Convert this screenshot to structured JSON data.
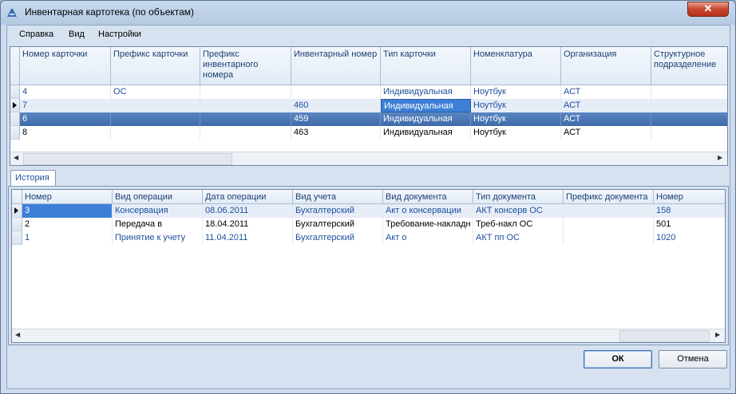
{
  "window": {
    "title": "Инвентарная картотека (по объектам)",
    "close_glyph": "✕"
  },
  "menu": {
    "items": [
      "Справка",
      "Вид",
      "Настройки"
    ]
  },
  "cards": {
    "columns": [
      "Номер карточки",
      "Префикс карточки",
      "Префикс инвентарного номера",
      "Инвентарный номер",
      "Тип карточки",
      "Номенклатура",
      "Организация",
      "Структурное подразделение"
    ],
    "rows": [
      [
        "4",
        "ОС",
        "",
        "",
        "Индивидуальная",
        "Ноутбук",
        "АСТ",
        ""
      ],
      [
        "7",
        "",
        "",
        "460",
        "Индивидуальная",
        "Ноутбук",
        "АСТ",
        ""
      ],
      [
        "6",
        "",
        "",
        "459",
        "Индивидуальная",
        "Ноутбук",
        "АСТ",
        ""
      ],
      [
        "8",
        "",
        "",
        "463",
        "Индивидуальная",
        "Ноутбук",
        "АСТ",
        ""
      ]
    ]
  },
  "history": {
    "tab_label": "История",
    "columns": [
      "Номер",
      "Вид операции",
      "Дата операции",
      "Вид учета",
      "Вид документа",
      "Тип документа",
      "Префикс документа",
      "Номер документа"
    ],
    "rows": [
      [
        "3",
        "Консервация",
        "08.06.2011",
        "Бухгалтерский",
        "Акт о консервации",
        "АКТ консерв ОС",
        "",
        "158"
      ],
      [
        "2",
        "Передача в",
        "18.04.2011",
        "Бухгалтерский",
        "Требование-накладн",
        "Треб-накл ОС",
        "",
        "501"
      ],
      [
        "1",
        "Принятие к учету",
        "11.04.2011",
        "Бухгалтерский",
        "Акт о",
        "АКТ пп ОС",
        "",
        "1020"
      ]
    ]
  },
  "buttons": {
    "ok": "ОК",
    "cancel": "Отмена"
  },
  "icons": {
    "scroll_left": "◀",
    "scroll_right": "▶"
  }
}
